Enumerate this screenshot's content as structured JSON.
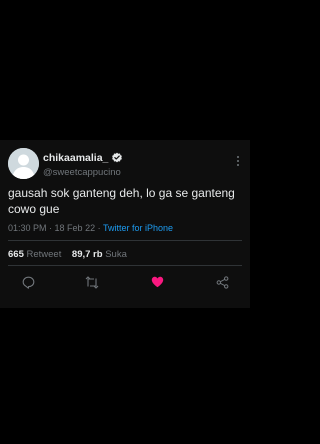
{
  "tweet": {
    "display_name": "chikaamalia_",
    "handle": "@sweetcappucino",
    "text": "gausah sok ganteng deh, lo ga se ganteng cowo gue",
    "time": "01:30 PM",
    "date": "18 Feb 22",
    "source": "Twitter for iPhone",
    "retweet_count": "665",
    "retweet_label": "Retweet",
    "like_count": "89,7 rb",
    "like_label": "Suka",
    "liked": true
  },
  "icons": {
    "verified": "verified-badge-icon",
    "more": "more-vertical-icon",
    "reply": "reply-icon",
    "retweet": "retweet-icon",
    "like": "heart-icon",
    "share": "share-icon"
  },
  "colors": {
    "background": "#000000",
    "card": "#0e0e0e",
    "primary_text": "#e7e9ea",
    "secondary_text": "#71767b",
    "link": "#1d9bf0",
    "like": "#f91880"
  }
}
